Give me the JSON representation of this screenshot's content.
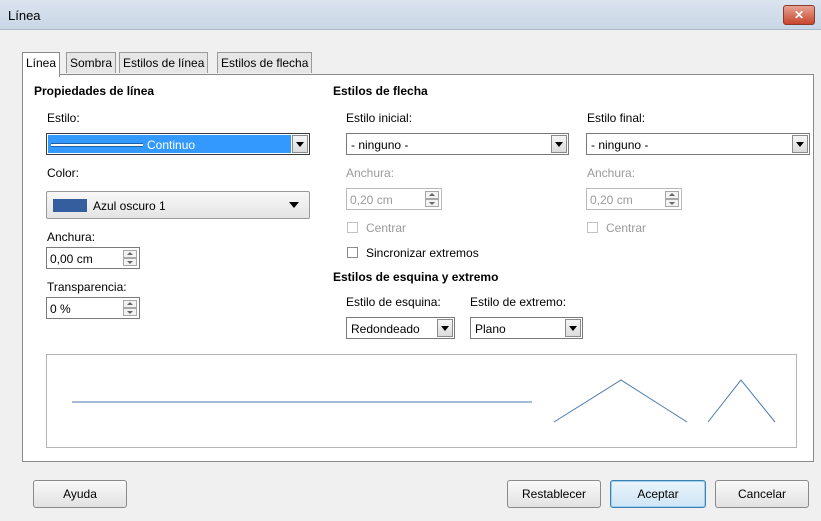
{
  "window": {
    "title": "Línea",
    "close_icon": "close-icon"
  },
  "tabs": [
    {
      "label": "Línea",
      "active": true
    },
    {
      "label": "Sombra"
    },
    {
      "label": "Estilos de línea"
    },
    {
      "label": "Estilos de flecha"
    }
  ],
  "line_props": {
    "header": "Propiedades de línea",
    "style_label": "Estilo:",
    "style_value": "Continuo",
    "color_label": "Color:",
    "color_value": "Azul oscuro 1",
    "color_swatch": "#355e9f",
    "width_label": "Anchura:",
    "width_value": "0,00 cm",
    "transparency_label": "Transparencia:",
    "transparency_value": "0 %"
  },
  "arrow_styles": {
    "header": "Estilos de flecha",
    "start_label": "Estilo inicial:",
    "start_value": "- ninguno -",
    "end_label": "Estilo final:",
    "end_value": "- ninguno -",
    "start_width_label": "Anchura:",
    "start_width_value": "0,20 cm",
    "end_width_label": "Anchura:",
    "end_width_value": "0,20 cm",
    "start_center_label": "Centrar",
    "end_center_label": "Centrar",
    "sync_label": "Sincronizar extremos"
  },
  "corner_styles": {
    "header": "Estilos de esquina y extremo",
    "corner_label": "Estilo de esquina:",
    "corner_value": "Redondeado",
    "cap_label": "Estilo de extremo:",
    "cap_value": "Plano"
  },
  "preview": {
    "line_color": "#4a7ab0"
  },
  "buttons": {
    "help": "Ayuda",
    "reset": "Restablecer",
    "ok": "Aceptar",
    "cancel": "Cancelar"
  }
}
